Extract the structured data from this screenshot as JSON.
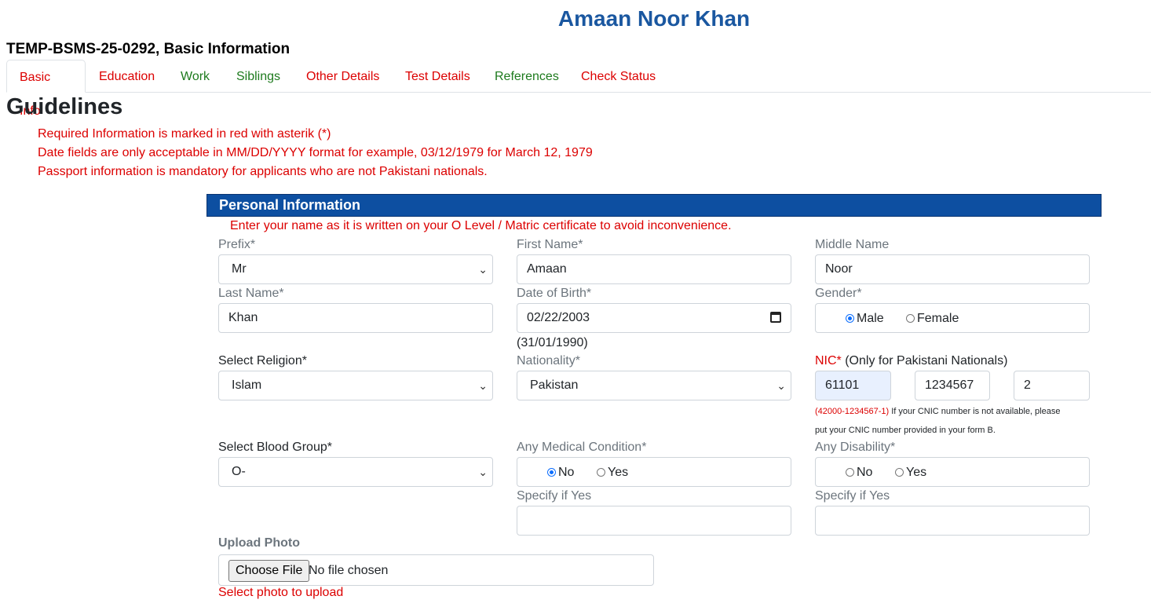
{
  "header": {
    "applicant_name": "Amaan Noor Khan",
    "subtitle": "TEMP-BSMS-25-0292, Basic Information"
  },
  "tabs": [
    {
      "label": "Basic Info",
      "status_color": "#dc0000",
      "active": true
    },
    {
      "label": "Education",
      "status_color": "#dc0000"
    },
    {
      "label": "Work",
      "status_color": "#1d7a1d"
    },
    {
      "label": "Siblings",
      "status_color": "#1d7a1d"
    },
    {
      "label": "Other Details",
      "status_color": "#dc0000"
    },
    {
      "label": "Test Details",
      "status_color": "#dc0000"
    },
    {
      "label": "References",
      "status_color": "#1d7a1d"
    },
    {
      "label": "Check Status",
      "status_color": "#dc0000"
    }
  ],
  "guidelines": {
    "heading": "Guidelines",
    "items": [
      "Required Information is marked in red with asterik (*)",
      "Date fields are only acceptable in MM/DD/YYYY format for example, 03/12/1979 for March 12, 1979",
      "Passport information is mandatory for applicants who are not Pakistani nationals."
    ]
  },
  "personal": {
    "section_title": "Personal Information",
    "note": "Enter your name as it is written on your O Level / Matric certificate to avoid inconvenience.",
    "prefix": {
      "label": "Prefix*",
      "value": "Mr"
    },
    "first_name": {
      "label": "First Name*",
      "value": "Amaan"
    },
    "middle_name": {
      "label": "Middle Name",
      "value": "Noor"
    },
    "last_name": {
      "label": "Last Name*",
      "value": "Khan"
    },
    "dob": {
      "label": "Date of Birth*",
      "value": "02/22/2003",
      "hint": "(31/01/1990)"
    },
    "gender": {
      "label": "Gender*",
      "options": [
        "Male",
        "Female"
      ],
      "selected": "Male"
    },
    "religion": {
      "label": "Select Religion*",
      "value": "Islam"
    },
    "nationality": {
      "label": "Nationality*",
      "value": "Pakistan"
    },
    "nic": {
      "label_required": "NIC*",
      "label_note": " (Only for Pakistani Nationals)",
      "part1": "61101",
      "part2": "1234567",
      "part3": "2",
      "hint_format": "(42000-1234567-1)",
      "hint_text_1": " If your CNIC number is not available, please",
      "hint_text_2": "put your CNIC number provided in your form B."
    },
    "blood_group": {
      "label": "Select Blood Group*",
      "value": "O-"
    },
    "medical": {
      "label": "Any Medical Condition*",
      "options": [
        "No",
        "Yes"
      ],
      "selected": "No",
      "specify_label": "Specify if Yes",
      "specify_value": ""
    },
    "disability": {
      "label": "Any Disability*",
      "options": [
        "No",
        "Yes"
      ],
      "selected": "",
      "specify_label": "Specify if Yes",
      "specify_value": ""
    },
    "photo": {
      "label": "Upload Photo",
      "button": "Choose File",
      "status": "No file chosen",
      "error": "Select photo to upload"
    }
  }
}
